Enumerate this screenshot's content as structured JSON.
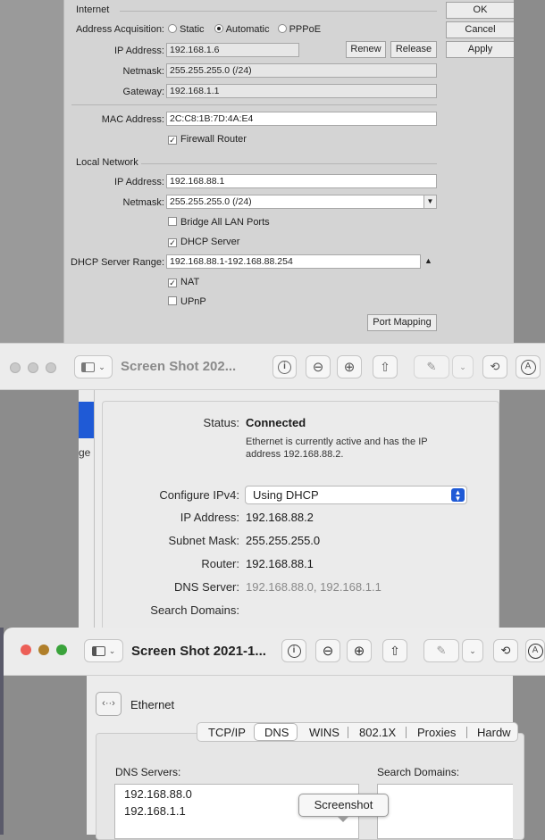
{
  "mikrotik": {
    "internet_group": "Internet",
    "address_acquisition_label": "Address Acquisition:",
    "acq_static": "Static",
    "acq_automatic": "Automatic",
    "acq_pppoe": "PPPoE",
    "acq_selected": "Automatic",
    "ip_label": "IP Address:",
    "ip_value": "192.168.1.6",
    "renew": "Renew",
    "release": "Release",
    "netmask_label": "Netmask:",
    "netmask_value": "255.255.255.0 (/24)",
    "gateway_label": "Gateway:",
    "gateway_value": "192.168.1.1",
    "mac_label": "MAC Address:",
    "mac_value": "2C:C8:1B:7D:4A:E4",
    "firewall_router": "Firewall Router",
    "local_group": "Local Network",
    "lan_ip_label": "IP Address:",
    "lan_ip_value": "192.168.88.1",
    "lan_netmask_label": "Netmask:",
    "lan_netmask_value": "255.255.255.0 (/24)",
    "bridge_all": "Bridge All LAN Ports",
    "dhcp_server": "DHCP Server",
    "dhcp_range_label": "DHCP Server Range:",
    "dhcp_range_value": "192.168.88.1-192.168.88.254",
    "nat": "NAT",
    "upnp": "UPnP",
    "port_mapping": "Port Mapping",
    "ok": "OK",
    "cancel": "Cancel",
    "apply": "Apply",
    "checks": {
      "firewall_router": true,
      "bridge_all": false,
      "dhcp_server": true,
      "nat": true,
      "upnp": false
    }
  },
  "preview1": {
    "title": "Screen Shot 202..."
  },
  "network": {
    "side_fragment": "ge",
    "status_label": "Status:",
    "status_value": "Connected",
    "status_desc_1": "Ethernet is currently active and has the IP",
    "status_desc_2": "address 192.168.88.2.",
    "configure_label": "Configure IPv4:",
    "configure_value": "Using DHCP",
    "ip_label": "IP Address:",
    "ip_value": "192.168.88.2",
    "subnet_label": "Subnet Mask:",
    "subnet_value": "255.255.255.0",
    "router_label": "Router:",
    "router_value": "192.168.88.1",
    "dns_label": "DNS Server:",
    "dns_value": "192.168.88.0, 192.168.1.1",
    "search_label": "Search Domains:"
  },
  "preview2": {
    "title": "Screen Shot 2021-1..."
  },
  "dns_pane": {
    "iface_name": "Ethernet",
    "tabs": [
      "TCP/IP",
      "DNS",
      "WINS",
      "802.1X",
      "Proxies",
      "Hardw"
    ],
    "active_tab": "DNS",
    "dns_servers_label": "DNS Servers:",
    "dns_servers": [
      "192.168.88.0",
      "192.168.1.1"
    ],
    "search_domains_label": "Search Domains:",
    "tooltip": "Screenshot"
  },
  "colors": {
    "close": "#ec5f57",
    "minimize": "#b07f2a",
    "zoom": "#3aa33b",
    "inactive_light": "#c9c9c9",
    "accent_blue": "#1f5ad6"
  }
}
